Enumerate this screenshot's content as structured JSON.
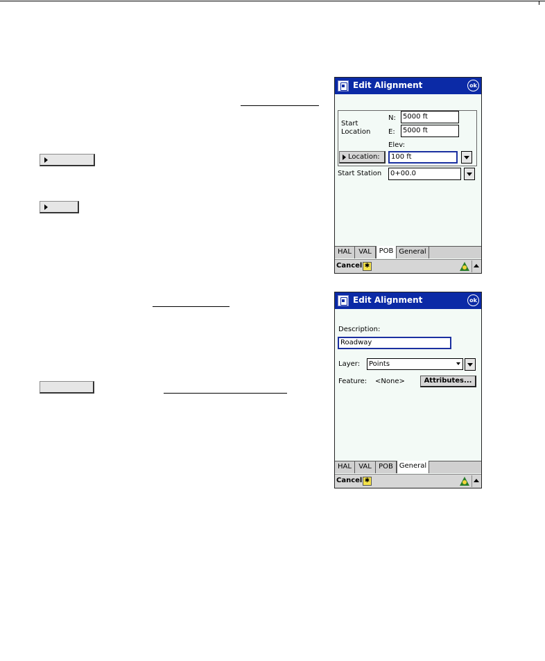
{
  "screen1": {
    "title": "Edit Alignment",
    "ok_label": "ok",
    "start_location_label": "Start\nLocation",
    "n_label": "N:",
    "n_value": "5000 ft",
    "e_label": "E:",
    "e_value": "5000 ft",
    "elev_label": "Elev:",
    "location_button": "Location:",
    "elev_value": "100 ft",
    "start_station_label": "Start Station",
    "start_station_value": "0+00.0",
    "tabs": [
      "HAL",
      "VAL",
      "POB",
      "General"
    ],
    "active_tab": "POB",
    "cancel_label": "Cancel"
  },
  "screen2": {
    "title": "Edit Alignment",
    "ok_label": "ok",
    "description_label": "Description:",
    "description_value": "Roadway",
    "layer_label": "Layer:",
    "layer_value": "Points",
    "feature_label": "Feature:",
    "feature_value": "<None>",
    "attributes_button": "Attributes...",
    "tabs": [
      "HAL",
      "VAL",
      "POB",
      "General"
    ],
    "active_tab": "General",
    "cancel_label": "Cancel"
  },
  "icons": {
    "app_icon": "alignment-app-icon",
    "ok": "ok-circle-icon",
    "dropdown": "chevron-down-icon",
    "sip": "input-panel-icon",
    "star": "favorite-star-icon"
  }
}
